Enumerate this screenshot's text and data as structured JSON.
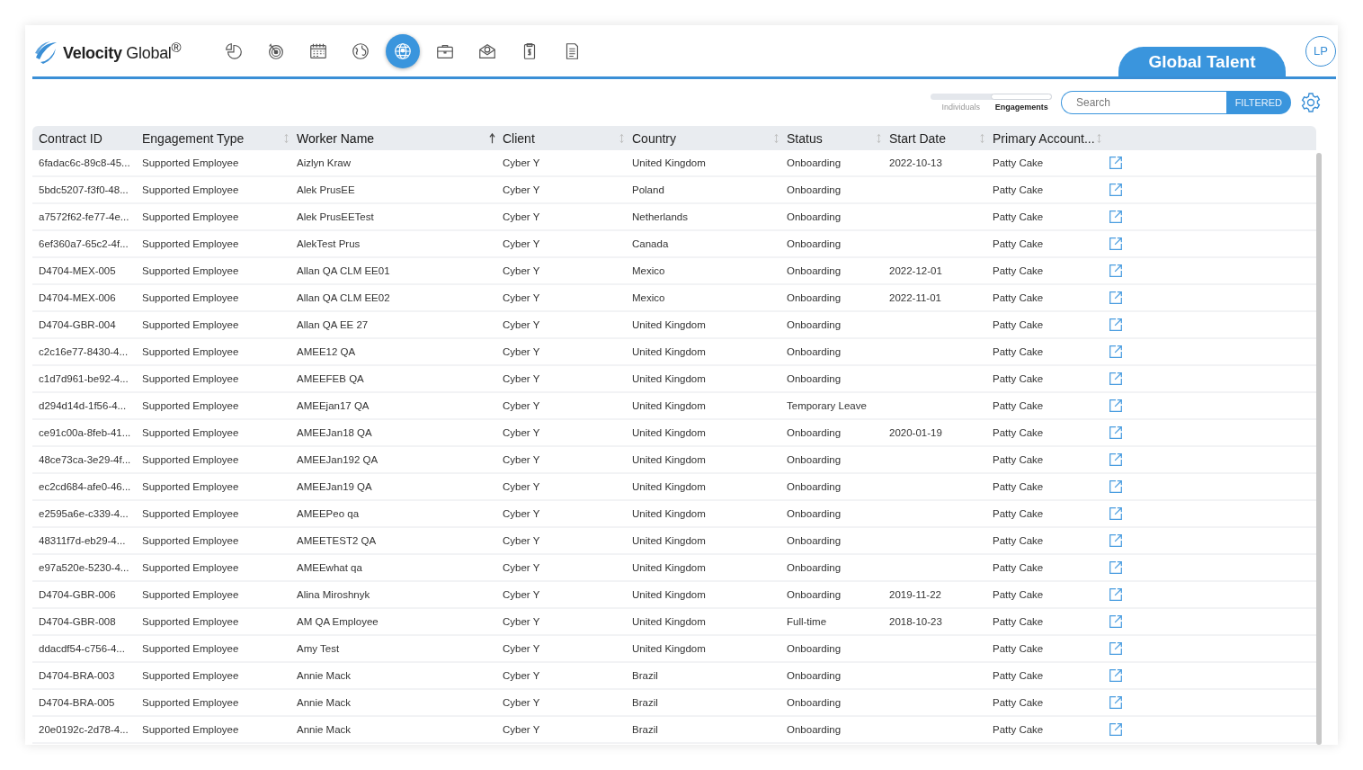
{
  "logo": {
    "text": "**Velocity** Global$^{®}$"
  },
  "nav_icons": [
    {
      "kind": "pie",
      "selected": false
    },
    {
      "kind": "target",
      "selected": false
    },
    {
      "kind": "calendar",
      "selected": false
    },
    {
      "kind": "globe",
      "selected": false
    },
    {
      "kind": "globe-person",
      "selected": true
    },
    {
      "kind": "briefcase",
      "selected": false
    },
    {
      "kind": "envelope",
      "selected": false
    },
    {
      "kind": "clipboard",
      "selected": false
    },
    {
      "kind": "document",
      "selected": false
    }
  ],
  "section_tab": {
    "label": "Global Talent"
  },
  "avatar": {
    "initials": "LP"
  },
  "view_toggle": [
    {
      "label": "Individuals",
      "selected": false
    },
    {
      "label": "Engagements",
      "selected": true
    }
  ],
  "search": {
    "placeholder": "Search",
    "filter_button": "FILTERED"
  },
  "table": {
    "columns": [
      {
        "label": "Contract ID",
        "sortable": false,
        "sorted": false
      },
      {
        "label": "Engagement Type",
        "sortable": true,
        "sorted": false
      },
      {
        "label": "Worker Name",
        "sortable": true,
        "sorted": true
      },
      {
        "label": "Client",
        "sortable": true,
        "sorted": false
      },
      {
        "label": "Country",
        "sortable": true,
        "sorted": false
      },
      {
        "label": "Status",
        "sortable": true,
        "sorted": false
      },
      {
        "label": "Start Date",
        "sortable": true,
        "sorted": false
      },
      {
        "label": "Primary Account...",
        "sortable": true,
        "sorted": false
      }
    ],
    "rows": [
      [
        "6fadac6c-89c8-45...",
        "Supported Employee",
        "Aizlyn Kraw",
        "Cyber Y",
        "United Kingdom",
        "Onboarding",
        "2022-10-13",
        "Patty Cake"
      ],
      [
        "5bdc5207-f3f0-48...",
        "Supported Employee",
        "Alek PrusEE",
        "Cyber Y",
        "Poland",
        "Onboarding",
        null,
        "Patty Cake"
      ],
      [
        "a7572f62-fe77-4e...",
        "Supported Employee",
        "Alek PrusEETest",
        "Cyber Y",
        "Netherlands",
        "Onboarding",
        null,
        "Patty Cake"
      ],
      [
        "6ef360a7-65c2-4f...",
        "Supported Employee",
        "AlekTest Prus",
        "Cyber Y",
        "Canada",
        "Onboarding",
        null,
        "Patty Cake"
      ],
      [
        "D4704-MEX-005",
        "Supported Employee",
        "Allan QA CLM EE01",
        "Cyber Y",
        "Mexico",
        "Onboarding",
        "2022-12-01",
        "Patty Cake"
      ],
      [
        "D4704-MEX-006",
        "Supported Employee",
        "Allan QA CLM EE02",
        "Cyber Y",
        "Mexico",
        "Onboarding",
        "2022-11-01",
        "Patty Cake"
      ],
      [
        "D4704-GBR-004",
        "Supported Employee",
        "Allan QA EE 27",
        "Cyber Y",
        "United Kingdom",
        "Onboarding",
        null,
        "Patty Cake"
      ],
      [
        "c2c16e77-8430-4...",
        "Supported Employee",
        "AMEE12 QA",
        "Cyber Y",
        "United Kingdom",
        "Onboarding",
        null,
        "Patty Cake"
      ],
      [
        "c1d7d961-be92-4...",
        "Supported Employee",
        "AMEEFEB QA",
        "Cyber Y",
        "United Kingdom",
        "Onboarding",
        null,
        "Patty Cake"
      ],
      [
        "d294d14d-1f56-4...",
        "Supported Employee",
        "AMEEjan17 QA",
        "Cyber Y",
        "United Kingdom",
        "Temporary Leave",
        null,
        "Patty Cake"
      ],
      [
        "ce91c00a-8feb-41...",
        "Supported Employee",
        "AMEEJan18 QA",
        "Cyber Y",
        "United Kingdom",
        "Onboarding",
        "2020-01-19",
        "Patty Cake"
      ],
      [
        "48ce73ca-3e29-4f...",
        "Supported Employee",
        "AMEEJan192 QA",
        "Cyber Y",
        "United Kingdom",
        "Onboarding",
        null,
        "Patty Cake"
      ],
      [
        "ec2cd684-afe0-46...",
        "Supported Employee",
        "AMEEJan19 QA",
        "Cyber Y",
        "United Kingdom",
        "Onboarding",
        null,
        "Patty Cake"
      ],
      [
        "e2595a6e-c339-4...",
        "Supported Employee",
        "AMEEPeo qa",
        "Cyber Y",
        "United Kingdom",
        "Onboarding",
        null,
        "Patty Cake"
      ],
      [
        "48311f7d-eb29-4...",
        "Supported Employee",
        "AMEETEST2 QA",
        "Cyber Y",
        "United Kingdom",
        "Onboarding",
        null,
        "Patty Cake"
      ],
      [
        "e97a520e-5230-4...",
        "Supported Employee",
        "AMEEwhat qa",
        "Cyber Y",
        "United Kingdom",
        "Onboarding",
        null,
        "Patty Cake"
      ],
      [
        "D4704-GBR-006",
        "Supported Employee",
        "Alina Miroshnyk",
        "Cyber Y",
        "United Kingdom",
        "Onboarding",
        "2019-11-22",
        "Patty Cake"
      ],
      [
        "D4704-GBR-008",
        "Supported Employee",
        "AM QA Employee",
        "Cyber Y",
        "United Kingdom",
        "Full-time",
        "2018-10-23",
        "Patty Cake"
      ],
      [
        "ddacdf54-c756-4...",
        "Supported Employee",
        "Amy Test",
        "Cyber Y",
        "United Kingdom",
        "Onboarding",
        null,
        "Patty Cake"
      ],
      [
        "D4704-BRA-003",
        "Supported Employee",
        "Annie Mack",
        "Cyber Y",
        "Brazil",
        "Onboarding",
        null,
        "Patty Cake"
      ],
      [
        "D4704-BRA-005",
        "Supported Employee",
        "Annie Mack",
        "Cyber Y",
        "Brazil",
        "Onboarding",
        null,
        "Patty Cake"
      ],
      [
        "20e0192c-2d78-4...",
        "Supported Employee",
        "Annie Mack",
        "Cyber Y",
        "Brazil",
        "Onboarding",
        null,
        "Patty Cake"
      ]
    ]
  }
}
